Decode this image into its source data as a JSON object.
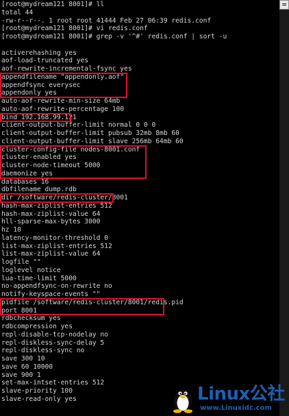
{
  "terminal": {
    "lines": [
      "[root@mydream121 8001]# ll",
      "total 44",
      "-rw-r--r--. 1 root root 41444 Feb 27 06:39 redis.conf",
      "[root@mydream121 8001]# vi redis.conf",
      "[root@mydream121 8001]# grep -v '^#' redis.conf | sort -u",
      "",
      "activerehashing yes",
      "aof-load-truncated yes",
      "aof-rewrite-incremental-fsync yes",
      "appendfilename \"appendonly.aof\"",
      "appendfsync everysec",
      "appendonly yes",
      "auto-aof-rewrite-min-size 64mb",
      "auto-aof-rewrite-percentage 100",
      "bind 192.168.99.121",
      "client-output-buffer-limit normal 0 0 0",
      "client-output-buffer-limit pubsub 32mb 8mb 60",
      "client-output-buffer-limit slave 256mb 64mb 60",
      "cluster-config-file nodes-8001.conf",
      "cluster-enabled yes",
      "cluster-node-timeout 5000",
      "daemonize yes",
      "databases 16",
      "dbfilename dump.rdb",
      "dir /software/redis-cluster/8001",
      "hash-max-ziplist-entries 512",
      "hash-max-ziplist-value 64",
      "hll-sparse-max-bytes 3000",
      "hz 10",
      "latency-monitor-threshold 0",
      "list-max-ziplist-entries 512",
      "list-max-ziplist-value 64",
      "logfile \"\"",
      "loglevel notice",
      "lua-time-limit 5000",
      "no-appendfsync-on-rewrite no",
      "notify-keyspace-events \"\"",
      "pidfile /software/redis-cluster/8001/redis.pid",
      "port 8001",
      "rdbchecksum yes",
      "rdbcompression yes",
      "repl-disable-tcp-nodelay no",
      "repl-diskless-sync-delay 5",
      "repl-diskless-sync no",
      "save 300 10",
      "save 60 10000",
      "save 900 1",
      "set-max-intset-entries 512",
      "slave-priority 100",
      "slave-read-only yes"
    ],
    "highlight_color": "#e0102a"
  },
  "scrollbar": {
    "button_glyph": "="
  },
  "watermark": {
    "brand": "Linux公社",
    "url": "www.Linuxidc.com"
  }
}
